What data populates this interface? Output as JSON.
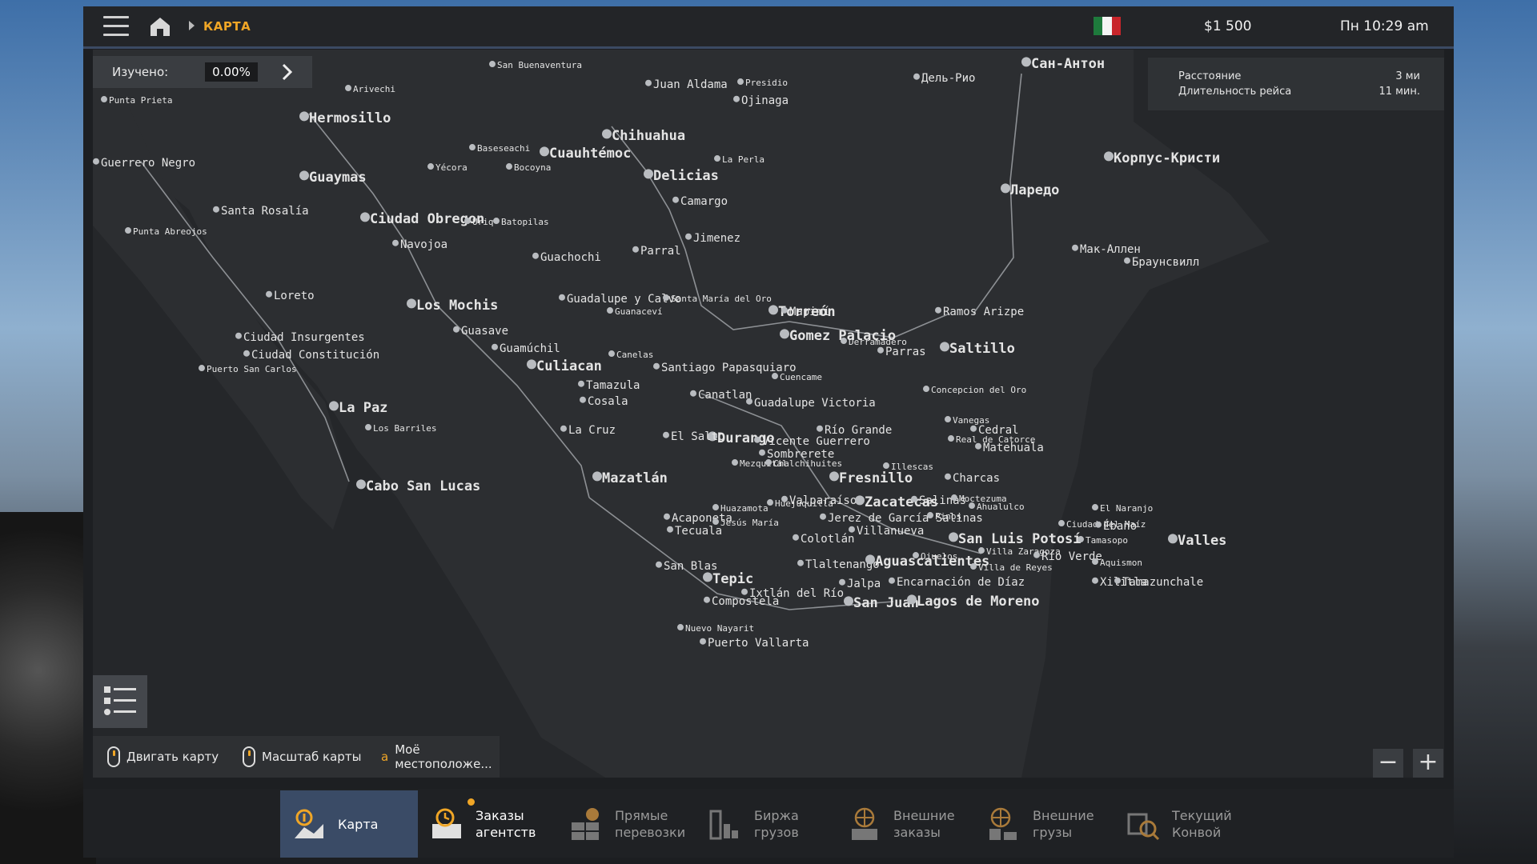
{
  "header": {
    "breadcrumb": "КАРТА",
    "money": "$1 500",
    "time": "Пн 10:29 am",
    "flag_colors": [
      "#1e7a3c",
      "#f4f4f4",
      "#c8252b"
    ]
  },
  "explored": {
    "label": "Изучено:",
    "value": "0.00%"
  },
  "trip": {
    "distance_label": "Расстояние",
    "distance_value": "3 ми",
    "duration_label": "Длительность рейса",
    "duration_value": "11 мин."
  },
  "map_labels": [
    {
      "t": "San Buenaventura",
      "s": "s"
    },
    {
      "t": "Arivechi",
      "s": "s"
    },
    {
      "t": "Juan Aldama",
      "s": "m"
    },
    {
      "t": "Presidio",
      "s": "s"
    },
    {
      "t": "Ojinaga",
      "s": "m"
    },
    {
      "t": "Дель-Рио",
      "s": "m"
    },
    {
      "t": "Сан-Антон",
      "s": "l"
    },
    {
      "t": "Punta Prieta",
      "s": "s"
    },
    {
      "t": "Hermosillo",
      "s": "l"
    },
    {
      "t": "Chihuahua",
      "s": "l"
    },
    {
      "t": "Baseseachi",
      "s": "s"
    },
    {
      "t": "Cuauhtémoc",
      "s": "l"
    },
    {
      "t": "Корпус-Кристи",
      "s": "l"
    },
    {
      "t": "Guerrero Negro",
      "s": "m"
    },
    {
      "t": "Guaymas",
      "s": "l"
    },
    {
      "t": "Yécora",
      "s": "s"
    },
    {
      "t": "Bocoyna",
      "s": "s"
    },
    {
      "t": "Delicias",
      "s": "l"
    },
    {
      "t": "La Perla",
      "s": "s"
    },
    {
      "t": "Ларедо",
      "s": "l"
    },
    {
      "t": "Camargo",
      "s": "m"
    },
    {
      "t": "Santa Rosalía",
      "s": "m"
    },
    {
      "t": "Ciudad Obregon",
      "s": "l"
    },
    {
      "t": "Uriq",
      "s": "s"
    },
    {
      "t": "Batopilas",
      "s": "s"
    },
    {
      "t": "Punta Abreojos",
      "s": "s"
    },
    {
      "t": "Jimenez",
      "s": "m"
    },
    {
      "t": "Navojoa",
      "s": "m"
    },
    {
      "t": "Мак-Аллен",
      "s": "m"
    },
    {
      "t": "Parral",
      "s": "m"
    },
    {
      "t": "Guachochi",
      "s": "m"
    },
    {
      "t": "Браунсвилл",
      "s": "m"
    },
    {
      "t": "Loreto",
      "s": "m"
    },
    {
      "t": "Los Mochis",
      "s": "l"
    },
    {
      "t": "Guadalupe y Calvo",
      "s": "m"
    },
    {
      "t": "Santa María del Oro",
      "s": "s"
    },
    {
      "t": "Torreón",
      "s": "l"
    },
    {
      "t": "Guanaceví",
      "s": "s"
    },
    {
      "t": "Mapimí",
      "s": "m"
    },
    {
      "t": "Ramos Arizpe",
      "s": "m"
    },
    {
      "t": "Guasave",
      "s": "m"
    },
    {
      "t": "Gomez Palacio",
      "s": "l"
    },
    {
      "t": "Ciudad Insurgentes",
      "s": "m"
    },
    {
      "t": "Saltillo",
      "s": "l"
    },
    {
      "t": "Parras",
      "s": "m"
    },
    {
      "t": "Derramadero",
      "s": "s"
    },
    {
      "t": "Guamúchil",
      "s": "m"
    },
    {
      "t": "Ciudad Constitución",
      "s": "m"
    },
    {
      "t": "Canelas",
      "s": "s"
    },
    {
      "t": "Culiacan",
      "s": "l"
    },
    {
      "t": "Santiago Papasquiaro",
      "s": "m"
    },
    {
      "t": "Puerto San Carlos",
      "s": "s"
    },
    {
      "t": "Cuencame",
      "s": "s"
    },
    {
      "t": "Tamazula",
      "s": "m"
    },
    {
      "t": "Concepcion del Oro",
      "s": "s"
    },
    {
      "t": "Canatlan",
      "s": "m"
    },
    {
      "t": "Cosala",
      "s": "m"
    },
    {
      "t": "La Paz",
      "s": "l"
    },
    {
      "t": "Guadalupe Victoria",
      "s": "m"
    },
    {
      "t": "Vanegas",
      "s": "s"
    },
    {
      "t": "Los Barriles",
      "s": "s"
    },
    {
      "t": "Cedral",
      "s": "m"
    },
    {
      "t": "La Cruz",
      "s": "m"
    },
    {
      "t": "Río Grande",
      "s": "m"
    },
    {
      "t": "Durango",
      "s": "l"
    },
    {
      "t": "El Salto",
      "s": "m"
    },
    {
      "t": "Vicente Guerrero",
      "s": "m"
    },
    {
      "t": "Real de Catorce",
      "s": "s"
    },
    {
      "t": "Matehuala",
      "s": "m"
    },
    {
      "t": "Sombrerete",
      "s": "m"
    },
    {
      "t": "Mezquital",
      "s": "s"
    },
    {
      "t": "Chalchihuites",
      "s": "s"
    },
    {
      "t": "Illescas",
      "s": "s"
    },
    {
      "t": "Fresnillo",
      "s": "l"
    },
    {
      "t": "Charcas",
      "s": "m"
    },
    {
      "t": "Mazatlán",
      "s": "l"
    },
    {
      "t": "Cabo San Lucas",
      "s": "l"
    },
    {
      "t": "Valparaíso",
      "s": "m"
    },
    {
      "t": "Zacatecas",
      "s": "l"
    },
    {
      "t": "Salinas",
      "s": "m"
    },
    {
      "t": "Moctezuma",
      "s": "s"
    },
    {
      "t": "Huejuquilla",
      "s": "s"
    },
    {
      "t": "Ahualulco",
      "s": "s"
    },
    {
      "t": "El Naranjo",
      "s": "s"
    },
    {
      "t": "Huazamota",
      "s": "s"
    },
    {
      "t": "Jerez de García Salinas",
      "s": "m"
    },
    {
      "t": "Acaponeta",
      "s": "m"
    },
    {
      "t": "Pinos",
      "s": "s"
    },
    {
      "t": "Jesús María",
      "s": "s"
    },
    {
      "t": "Ciudad del Maíz",
      "s": "s"
    },
    {
      "t": "Ébano",
      "s": "m"
    },
    {
      "t": "Tecuala",
      "s": "m"
    },
    {
      "t": "Villanueva",
      "s": "m"
    },
    {
      "t": "Colotlán",
      "s": "m"
    },
    {
      "t": "San Luis Potosí",
      "s": "l"
    },
    {
      "t": "Tamasopo",
      "s": "s"
    },
    {
      "t": "Valles",
      "s": "l"
    },
    {
      "t": "Ojuelos",
      "s": "s"
    },
    {
      "t": "Villa Zaragoza",
      "s": "s"
    },
    {
      "t": "Río Verde",
      "s": "m"
    },
    {
      "t": "Tlaltenango",
      "s": "m"
    },
    {
      "t": "Aguascalientes",
      "s": "l"
    },
    {
      "t": "Aquismon",
      "s": "s"
    },
    {
      "t": "San Blas",
      "s": "m"
    },
    {
      "t": "Villa de Reyes",
      "s": "s"
    },
    {
      "t": "Xilitla",
      "s": "m"
    },
    {
      "t": "Tamazunchale",
      "s": "m"
    },
    {
      "t": "Tepic",
      "s": "l"
    },
    {
      "t": "Jalpa",
      "s": "m"
    },
    {
      "t": "Encarnación de Díaz",
      "s": "m"
    },
    {
      "t": "Ixtlán del Río",
      "s": "m"
    },
    {
      "t": "Compostela",
      "s": "m"
    },
    {
      "t": "San Juan",
      "s": "l"
    },
    {
      "t": "Lagos de Moreno",
      "s": "l"
    },
    {
      "t": "Nuevo Nayarit",
      "s": "s"
    },
    {
      "t": "Puerto Vallarta",
      "s": "m"
    }
  ],
  "map_controls": {
    "move": "Двигать карту",
    "scale": "Масштаб карты",
    "location_key": "a",
    "location_line1": "Моё",
    "location_line2": "местоположе...",
    "zoom_out": "−",
    "zoom_in": "+"
  },
  "tabs": [
    {
      "l1": "Карта",
      "l2": "",
      "icon": "map-pin-icon"
    },
    {
      "l1": "Заказы",
      "l2": "агентств",
      "icon": "agency-orders-icon"
    },
    {
      "l1": "Прямые",
      "l2": "перевозки",
      "icon": "direct-transport-icon"
    },
    {
      "l1": "Биржа",
      "l2": "грузов",
      "icon": "cargo-market-icon"
    },
    {
      "l1": "Внешние",
      "l2": "заказы",
      "icon": "external-orders-icon"
    },
    {
      "l1": "Внешние",
      "l2": "грузы",
      "icon": "external-cargo-icon"
    },
    {
      "l1": "Текущий",
      "l2": "Конвой",
      "icon": "convoy-icon"
    }
  ],
  "colors": {
    "accent": "#f0a626",
    "active_tab": "#3a4b66",
    "map_bg": "#25272a"
  }
}
